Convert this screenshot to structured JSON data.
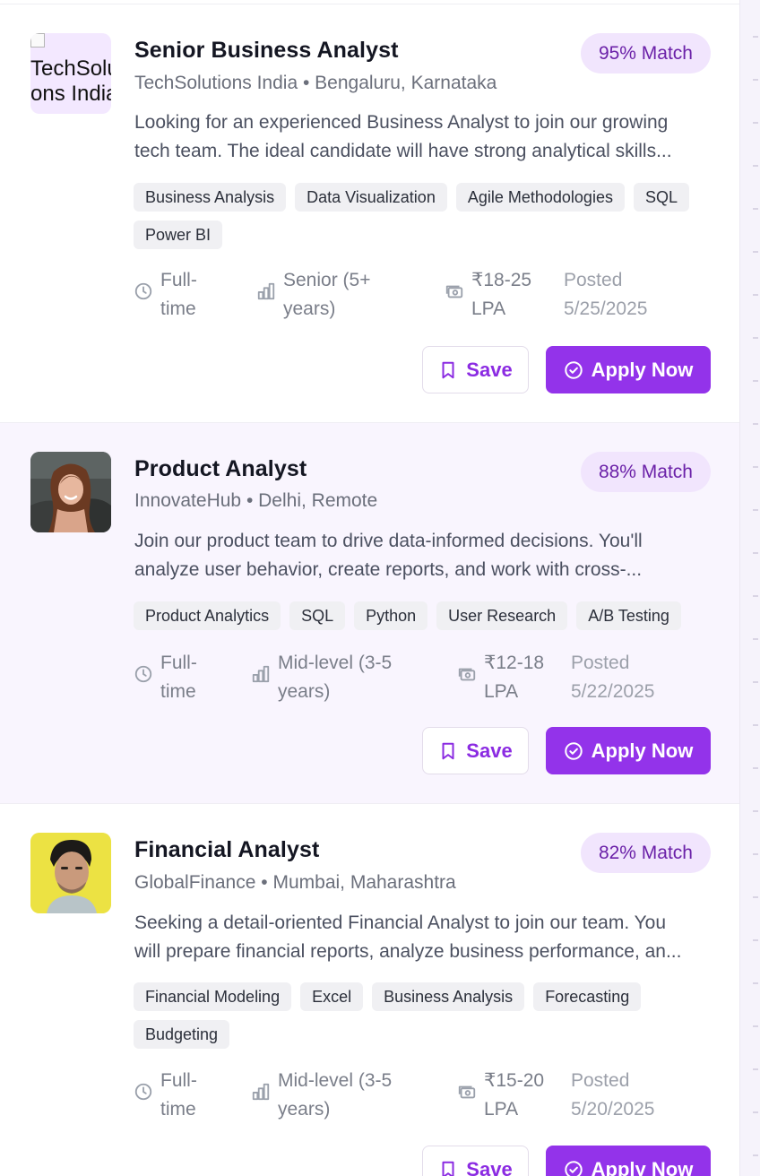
{
  "colors": {
    "accent": "#9333ea",
    "match_bg": "#f1e5fd",
    "match_text": "#6b21a8",
    "highlight_bg": "#f9f5fe"
  },
  "jobs": [
    {
      "title": "Senior Business Analyst",
      "company": "TechSolutions India",
      "location": "Bengaluru, Karnataka",
      "separator": "•",
      "logo_alt": "TechSolutions India",
      "match": "95% Match",
      "description_lines": [
        "Looking for an experienced Business Analyst to join our growing",
        "tech team. The ideal candidate will have strong analytical skills..."
      ],
      "tags": [
        "Business Analysis",
        "Data Visualization",
        "Agile Methodologies",
        "SQL",
        "Power BI"
      ],
      "job_type_lines": [
        "Full-",
        "time"
      ],
      "experience_lines": [
        "Senior (5+",
        "years)"
      ],
      "salary_lines": [
        "₹18-25",
        "LPA"
      ],
      "posted_lines": [
        "Posted",
        "5/25/2025"
      ],
      "save_label": "Save",
      "apply_label": "Apply Now"
    },
    {
      "title": "Product Analyst",
      "company": "InnovateHub",
      "location": "Delhi, Remote",
      "separator": "•",
      "match": "88% Match",
      "description_lines": [
        "Join our product team to drive data-informed decisions. You'll",
        "analyze user behavior, create reports, and work with cross-..."
      ],
      "tags": [
        "Product Analytics",
        "SQL",
        "Python",
        "User Research",
        "A/B Testing"
      ],
      "job_type_lines": [
        "Full-",
        "time"
      ],
      "experience_lines": [
        "Mid-level (3-5",
        "years)"
      ],
      "salary_lines": [
        "₹12-18",
        "LPA"
      ],
      "posted_lines": [
        "Posted",
        "5/22/2025"
      ],
      "save_label": "Save",
      "apply_label": "Apply Now"
    },
    {
      "title": "Financial Analyst",
      "company": "GlobalFinance",
      "location": "Mumbai, Maharashtra",
      "separator": "•",
      "match": "82% Match",
      "description_lines": [
        "Seeking a detail-oriented Financial Analyst to join our team. You",
        "will prepare financial reports, analyze business performance, an..."
      ],
      "tags": [
        "Financial Modeling",
        "Excel",
        "Business Analysis",
        "Forecasting",
        "Budgeting"
      ],
      "job_type_lines": [
        "Full-",
        "time"
      ],
      "experience_lines": [
        "Mid-level (3-5",
        "years)"
      ],
      "salary_lines": [
        "₹15-20",
        "LPA"
      ],
      "posted_lines": [
        "Posted",
        "5/20/2025"
      ],
      "save_label": "Save",
      "apply_label": "Apply Now"
    }
  ]
}
